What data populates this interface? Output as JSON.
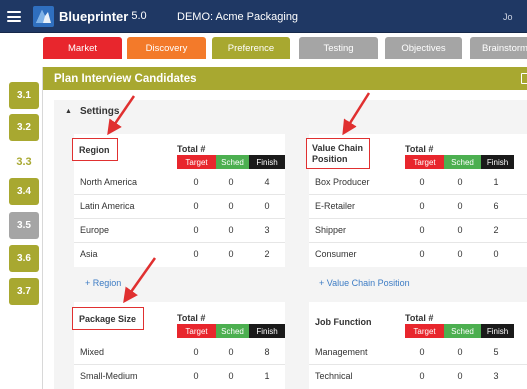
{
  "app": {
    "brand": "Blueprinter",
    "version": "5.0",
    "project": "DEMO: Acme Packaging",
    "top_right": "Jo"
  },
  "tabs": [
    {
      "label": "Market"
    },
    {
      "label": "Discovery"
    },
    {
      "label": "Preference"
    },
    {
      "label": "Testing"
    },
    {
      "label": "Objectives"
    },
    {
      "label": "Brainstorm"
    }
  ],
  "steps": [
    {
      "label": "3.1"
    },
    {
      "label": "3.2"
    },
    {
      "label": "3.3"
    },
    {
      "label": "3.4"
    },
    {
      "label": "3.5"
    },
    {
      "label": "3.6"
    },
    {
      "label": "3.7"
    }
  ],
  "panel": {
    "title": "Plan Interview Candidates",
    "settings_label": "Settings"
  },
  "headers": {
    "total": "Total #",
    "target": "Target",
    "sched": "Sched",
    "finish": "Finish"
  },
  "region": {
    "title": "Region",
    "rows": [
      {
        "label": "North America",
        "target": "0",
        "sched": "0",
        "finish": "4"
      },
      {
        "label": "Latin America",
        "target": "0",
        "sched": "0",
        "finish": "0"
      },
      {
        "label": "Europe",
        "target": "0",
        "sched": "0",
        "finish": "3"
      },
      {
        "label": "Asia",
        "target": "0",
        "sched": "0",
        "finish": "2"
      }
    ],
    "add_label": "+ Region"
  },
  "value_chain": {
    "title_line1": "Value Chain",
    "title_line2": "Position",
    "rows": [
      {
        "label": "Box Producer",
        "target": "0",
        "sched": "0",
        "finish": "1"
      },
      {
        "label": "E-Retailer",
        "target": "0",
        "sched": "0",
        "finish": "6"
      },
      {
        "label": "Shipper",
        "target": "0",
        "sched": "0",
        "finish": "2"
      },
      {
        "label": "Consumer",
        "target": "0",
        "sched": "0",
        "finish": "0"
      }
    ],
    "add_label": "+ Value Chain Position"
  },
  "package_size": {
    "title": "Package Size",
    "rows": [
      {
        "label": "Mixed",
        "target": "0",
        "sched": "0",
        "finish": "8"
      },
      {
        "label": "Small-Medium",
        "target": "0",
        "sched": "0",
        "finish": "1"
      }
    ]
  },
  "job_function": {
    "title": "Job Function",
    "rows": [
      {
        "label": "Management",
        "target": "0",
        "sched": "0",
        "finish": "5"
      },
      {
        "label": "Technical",
        "target": "0",
        "sched": "0",
        "finish": "3"
      }
    ]
  },
  "colors": {
    "topbar": "#1f3864",
    "olive": "#a8a830",
    "red": "#e8262d",
    "orange": "#f37a2a",
    "grey": "#a5a5a5",
    "green": "#4caf50",
    "black": "#1a1a1a",
    "link": "#3d7cc4",
    "annotation_red": "#e03030"
  }
}
